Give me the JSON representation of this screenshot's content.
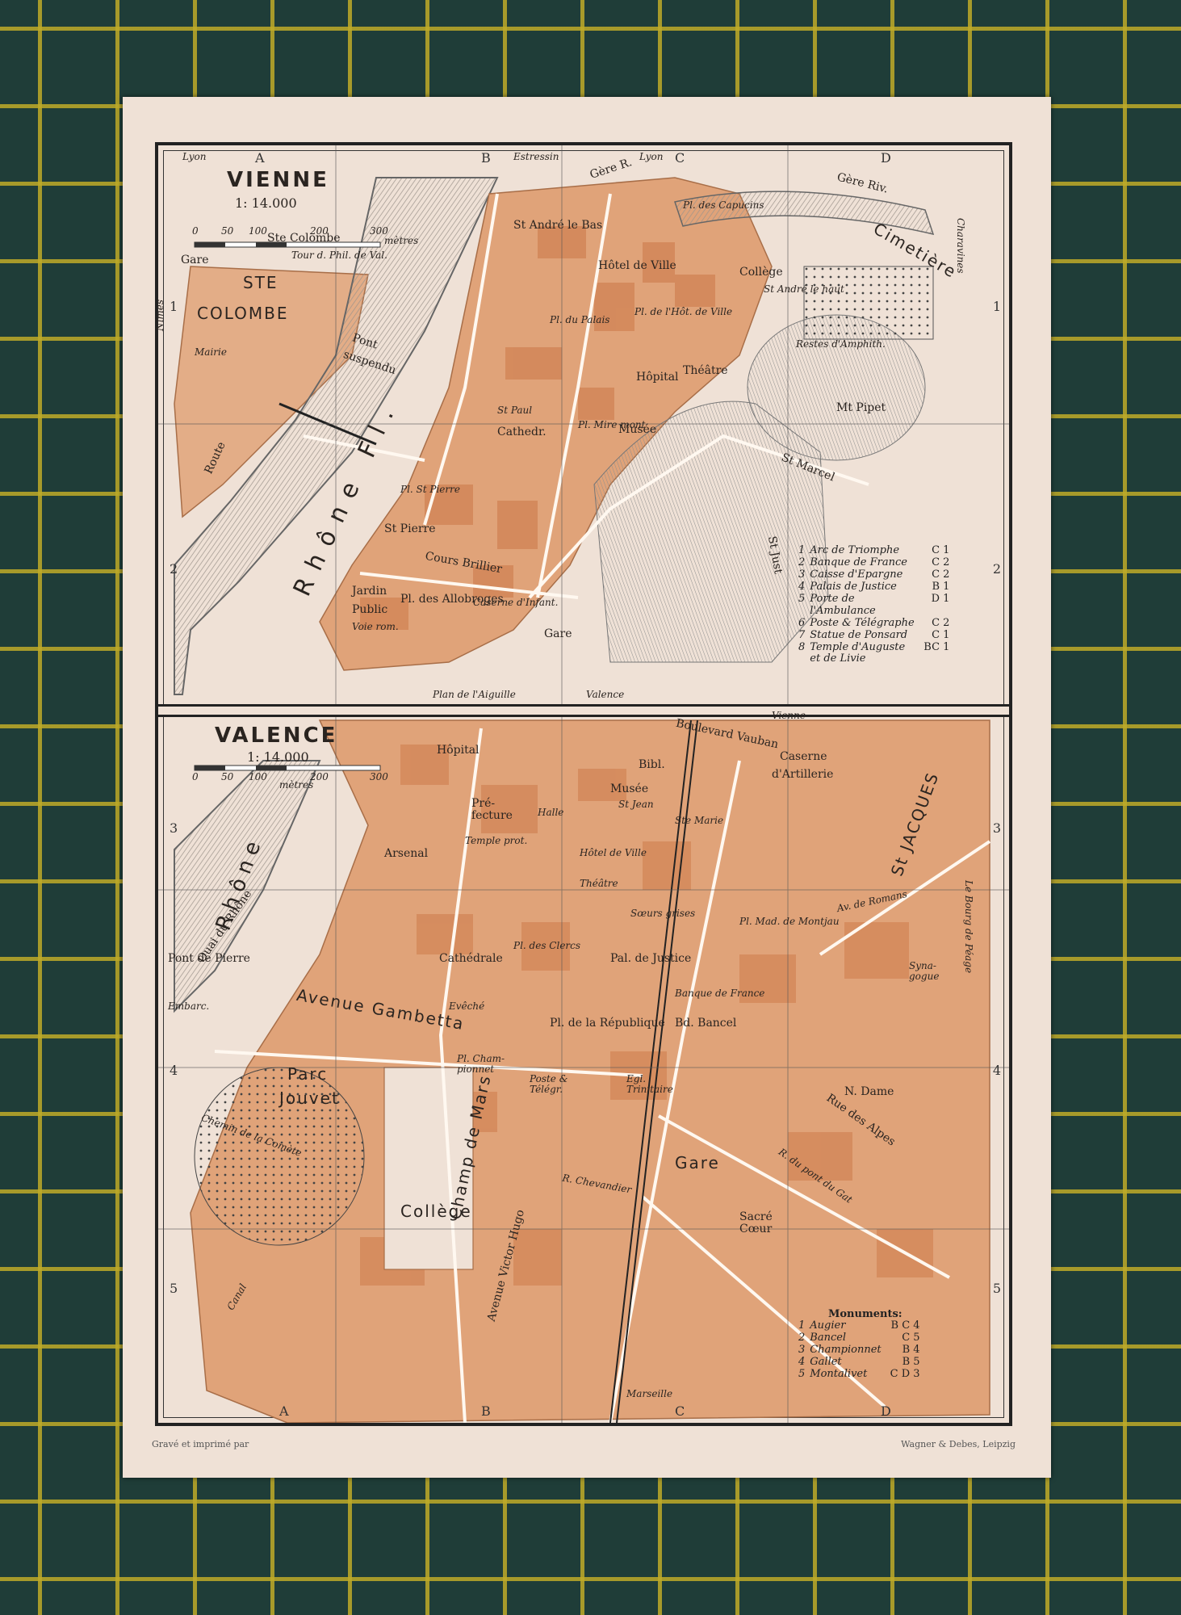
{
  "colors": {
    "background": "#1f3d38",
    "grid": "#beaa28",
    "paper": "#efe1d6",
    "built": "#e0a379",
    "built_dark": "#cf7e4f",
    "river": "#b9b4ae",
    "frame": "#222222"
  },
  "vienne": {
    "title": "VIENNE",
    "scale": "1: 14.000",
    "scale_ticks": [
      "0",
      "50",
      "100",
      "200",
      "300"
    ],
    "scale_unit": "mètres",
    "labels": {
      "lyon_tl": "Lyon",
      "estressin": "Estressin",
      "lyon_top": "Lyon",
      "gere_r": "Gère R.",
      "gere_riv": "Gère Riv.",
      "charavines": "Charavines",
      "gare_top": "Gare",
      "ste_colombe_church": "Ste Colombe",
      "tour": "Tour d. Phil. de Val.",
      "ste": "STE",
      "colombe": "COLOMBE",
      "mairie": "Mairie",
      "nimes": "Nîmes",
      "route": "Route",
      "pont": "Pont",
      "suspendu": "suspendu",
      "rhone_fl": "Rhône Fl.",
      "st_andre_le_bas": "St André le Bas",
      "pl_capucins": "Pl. des Capucins",
      "college": "Collège",
      "st_andre_le_haut": "St André le haut",
      "cimetiere": "Cimetière",
      "hotel_de_ville": "Hôtel de Ville",
      "pl_du_palais": "Pl. du Palais",
      "pl_hotel_ville": "Pl. de l'Hôt. de Ville",
      "restes": "Restes d'Amphith.",
      "hopital": "Hôpital",
      "theatre": "Théâtre",
      "mt_pipet": "Mt Pipet",
      "st_paul": "St Paul",
      "cathedr": "Cathedr.",
      "mire_mont": "Pl. Mire mont",
      "musee": "Musée",
      "pl_st_pierre": "Pl. St Pierre",
      "st_pierre": "St Pierre",
      "st_just": "St Just",
      "st_marcel": "St Marcel",
      "jardin": "Jardin",
      "public": "Public",
      "pl_des_allobroges": "Pl. des Allobroges",
      "voie_rom": "Voie rom.",
      "caserne": "Caserne d'Infant.",
      "gare": "Gare",
      "cours_brillier": "Cours Brillier",
      "plan_aiguille": "Plan de l'Aiguille",
      "valence": "Valence"
    },
    "legend": [
      {
        "num": "1",
        "name": "Arc de Triomphe",
        "code": "C 1"
      },
      {
        "num": "2",
        "name": "Banque de France",
        "code": "C 2"
      },
      {
        "num": "3",
        "name": "Caisse d'Epargne",
        "code": "C 2"
      },
      {
        "num": "4",
        "name": "Palais de Justice",
        "code": "B 1"
      },
      {
        "num": "5",
        "name": "Porte de l'Ambulance",
        "code": "D 1"
      },
      {
        "num": "6",
        "name": "Poste & Télégraphe",
        "code": "C 2"
      },
      {
        "num": "7",
        "name": "Statue de Ponsard",
        "code": "C 1"
      },
      {
        "num": "8",
        "name": "Temple d'Auguste et de Livie",
        "code": "BC 1"
      }
    ]
  },
  "valence": {
    "title": "VALENCE",
    "scale": "1: 14.000",
    "scale_ticks": [
      "0",
      "50",
      "100",
      "200",
      "300"
    ],
    "scale_unit": "mètres",
    "labels": {
      "vienne": "Vienne",
      "hopital": "Hôpital",
      "bibl": "Bibl.",
      "musee": "Musée",
      "st_jean": "St Jean",
      "bd_vauban": "Boulevard Vauban",
      "caserne": "Caserne",
      "artillerie": "d'Artillerie",
      "prefecture": "Pré- fecture",
      "halle": "Halle",
      "ste_marie": "Ste Marie",
      "temple_prot": "Temple prot.",
      "arsenal": "Arsenal",
      "hotel_de_ville": "Hôtel de Ville",
      "theatre": "Théâtre",
      "st_jacques": "St JACQUES",
      "le_bourg": "Le Bourg de Péage",
      "rhone": "Rhône",
      "soeurs_grises": "Sœurs grises",
      "pl_mad_montjau": "Pl. Mad. de Montjau",
      "av_romans": "Av. de Romans",
      "cathedrale": "Cathédrale",
      "pl_des_clercs": "Pl. des Clercs",
      "pal_justice": "Pal. de Justice",
      "banque": "Banque de France",
      "synagogue": "Syna- gogue",
      "pont_de_pierre": "Pont de Pierre",
      "embarc": "Embarc.",
      "av_gambetta": "Avenue Gambetta",
      "pl_republique": "Pl. de la République",
      "bd_bancel": "Bd. Bancel",
      "evechi": "Evêché",
      "pl_championnet": "Pl. Cham- pionnet",
      "parc": "Parc",
      "jouvet": "Jouvet",
      "poste": "Poste & Télégr.",
      "egl_trinitaire": "Egl. Trinitaire",
      "n_dame": "N. Dame",
      "champ_de_mars": "Champ de Mars",
      "chemin": "Chemin de la Comète",
      "gare": "Gare",
      "college": "Collège",
      "r_chevandier": "R. Chevandier",
      "av_victor_hugo": "Avenue Victor Hugo",
      "sacre_coeur": "Sacré Cœur",
      "canal": "Canal",
      "marseille": "Marseille",
      "rue_des_alpes": "Rue des Alpes",
      "pont_du_gat": "R. du pont du Gat",
      "quai": "Quai du Rhône"
    },
    "legend_title": "Monuments:",
    "legend": [
      {
        "num": "1",
        "name": "Augier",
        "code": "B C 4"
      },
      {
        "num": "2",
        "name": "Bancel",
        "code": "C 5"
      },
      {
        "num": "3",
        "name": "Championnet",
        "code": "B 4"
      },
      {
        "num": "4",
        "name": "Gallet",
        "code": "B 5"
      },
      {
        "num": "5",
        "name": "Montalivet",
        "code": "C D 3"
      }
    ]
  },
  "grid": {
    "columns": [
      "A",
      "B",
      "C",
      "D"
    ],
    "rows": [
      "1",
      "2",
      "3",
      "4",
      "5"
    ]
  },
  "footer": {
    "left": "Gravé et imprimé par",
    "right": "Wagner & Debes, Leipzig"
  }
}
